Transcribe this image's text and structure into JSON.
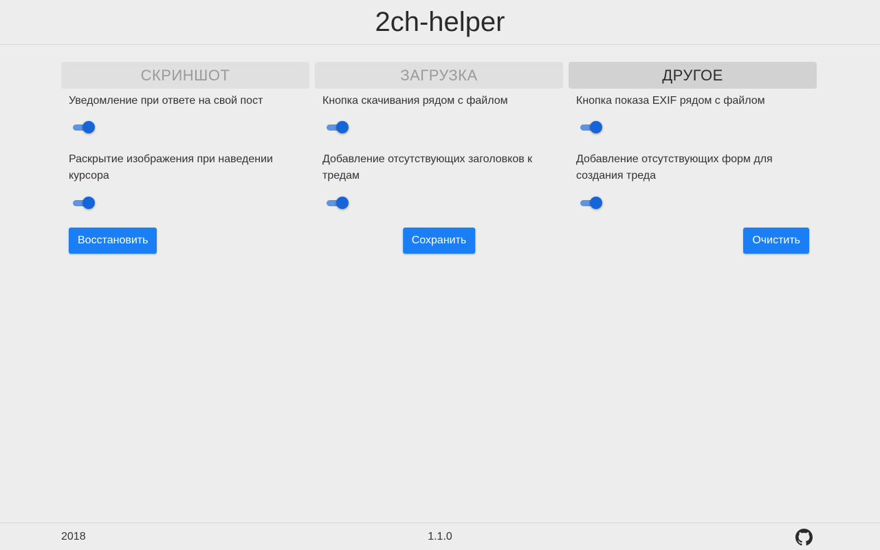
{
  "header": {
    "title": "2ch-helper"
  },
  "tabs": [
    {
      "label": "СКРИНШОТ",
      "active": false
    },
    {
      "label": "ЗАГРУЗКА",
      "active": false
    },
    {
      "label": "ДРУГОЕ",
      "active": true
    }
  ],
  "columns": [
    {
      "settings": [
        {
          "label": "Уведомление при ответе на свой пост",
          "enabled": true
        },
        {
          "label": "Раскрытие изображения при наведении курсора",
          "enabled": true
        }
      ],
      "button_label": "Восстановить"
    },
    {
      "settings": [
        {
          "label": "Кнопка скачивания рядом с файлом",
          "enabled": true
        },
        {
          "label": "Добавление отсутствующих заголовков к тредам",
          "enabled": true
        }
      ],
      "button_label": "Сохранить"
    },
    {
      "settings": [
        {
          "label": "Кнопка показа EXIF рядом с файлом",
          "enabled": true
        },
        {
          "label": "Добавление отсутствующих форм для создания треда",
          "enabled": true
        }
      ],
      "button_label": "Очистить"
    }
  ],
  "footer": {
    "year": "2018",
    "version": "1.1.0",
    "link_icon": "github-icon"
  },
  "colors": {
    "background": "#ededed",
    "accent": "#1a7ef5",
    "switch_thumb": "#1565d8",
    "switch_track": "#5d95e3",
    "tab_active_bg": "#d2d2d2",
    "tab_inactive_bg": "#e0e0e0"
  }
}
